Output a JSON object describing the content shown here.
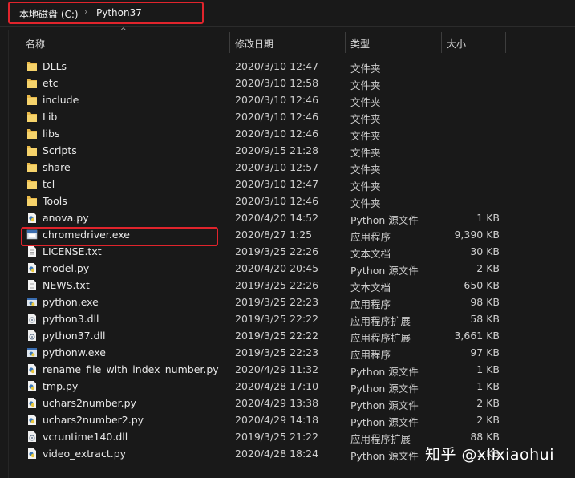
{
  "breadcrumb": {
    "drive": "本地磁盘 (C:)",
    "separator": "›",
    "folder": "Python37"
  },
  "columns": {
    "name": "名称",
    "date": "修改日期",
    "type": "类型",
    "size": "大小",
    "sort_indicator": "^"
  },
  "files": [
    {
      "name": "DLLs",
      "date": "2020/3/10 12:47",
      "type": "文件夹",
      "size": "",
      "icon": "folder-icon"
    },
    {
      "name": "etc",
      "date": "2020/3/10 12:58",
      "type": "文件夹",
      "size": "",
      "icon": "folder-icon"
    },
    {
      "name": "include",
      "date": "2020/3/10 12:46",
      "type": "文件夹",
      "size": "",
      "icon": "folder-icon"
    },
    {
      "name": "Lib",
      "date": "2020/3/10 12:46",
      "type": "文件夹",
      "size": "",
      "icon": "folder-icon"
    },
    {
      "name": "libs",
      "date": "2020/3/10 12:46",
      "type": "文件夹",
      "size": "",
      "icon": "folder-icon"
    },
    {
      "name": "Scripts",
      "date": "2020/9/15 21:28",
      "type": "文件夹",
      "size": "",
      "icon": "folder-icon"
    },
    {
      "name": "share",
      "date": "2020/3/10 12:57",
      "type": "文件夹",
      "size": "",
      "icon": "folder-icon"
    },
    {
      "name": "tcl",
      "date": "2020/3/10 12:47",
      "type": "文件夹",
      "size": "",
      "icon": "folder-icon"
    },
    {
      "name": "Tools",
      "date": "2020/3/10 12:46",
      "type": "文件夹",
      "size": "",
      "icon": "folder-icon"
    },
    {
      "name": "anova.py",
      "date": "2020/4/20 14:52",
      "type": "Python 源文件",
      "size": "1 KB",
      "icon": "python-file-icon"
    },
    {
      "name": "chromedriver.exe",
      "date": "2020/8/27 1:25",
      "type": "应用程序",
      "size": "9,390 KB",
      "icon": "exe-icon"
    },
    {
      "name": "LICENSE.txt",
      "date": "2019/3/25 22:26",
      "type": "文本文档",
      "size": "30 KB",
      "icon": "text-file-icon"
    },
    {
      "name": "model.py",
      "date": "2020/4/20 20:45",
      "type": "Python 源文件",
      "size": "2 KB",
      "icon": "python-file-icon"
    },
    {
      "name": "NEWS.txt",
      "date": "2019/3/25 22:26",
      "type": "文本文档",
      "size": "650 KB",
      "icon": "text-file-icon"
    },
    {
      "name": "python.exe",
      "date": "2019/3/25 22:23",
      "type": "应用程序",
      "size": "98 KB",
      "icon": "python-exe-icon"
    },
    {
      "name": "python3.dll",
      "date": "2019/3/25 22:22",
      "type": "应用程序扩展",
      "size": "58 KB",
      "icon": "dll-icon"
    },
    {
      "name": "python37.dll",
      "date": "2019/3/25 22:22",
      "type": "应用程序扩展",
      "size": "3,661 KB",
      "icon": "dll-icon"
    },
    {
      "name": "pythonw.exe",
      "date": "2019/3/25 22:23",
      "type": "应用程序",
      "size": "97 KB",
      "icon": "python-exe-icon"
    },
    {
      "name": "rename_file_with_index_number.py",
      "date": "2020/4/29 11:32",
      "type": "Python 源文件",
      "size": "1 KB",
      "icon": "python-file-icon"
    },
    {
      "name": "tmp.py",
      "date": "2020/4/28 17:10",
      "type": "Python 源文件",
      "size": "1 KB",
      "icon": "python-file-icon"
    },
    {
      "name": "uchars2number.py",
      "date": "2020/4/29 13:38",
      "type": "Python 源文件",
      "size": "2 KB",
      "icon": "python-file-icon"
    },
    {
      "name": "uchars2number2.py",
      "date": "2020/4/29 14:18",
      "type": "Python 源文件",
      "size": "2 KB",
      "icon": "python-file-icon"
    },
    {
      "name": "vcruntime140.dll",
      "date": "2019/3/25 21:22",
      "type": "应用程序扩展",
      "size": "88 KB",
      "icon": "dll-icon"
    },
    {
      "name": "video_extract.py",
      "date": "2020/4/28 18:24",
      "type": "Python 源文件",
      "size": "1 KB",
      "icon": "python-file-icon"
    }
  ],
  "watermark": "知乎 @xlixiaohui",
  "colors": {
    "background": "#191919",
    "highlight_border": "#e0242c",
    "folder": "#f2c84b"
  }
}
